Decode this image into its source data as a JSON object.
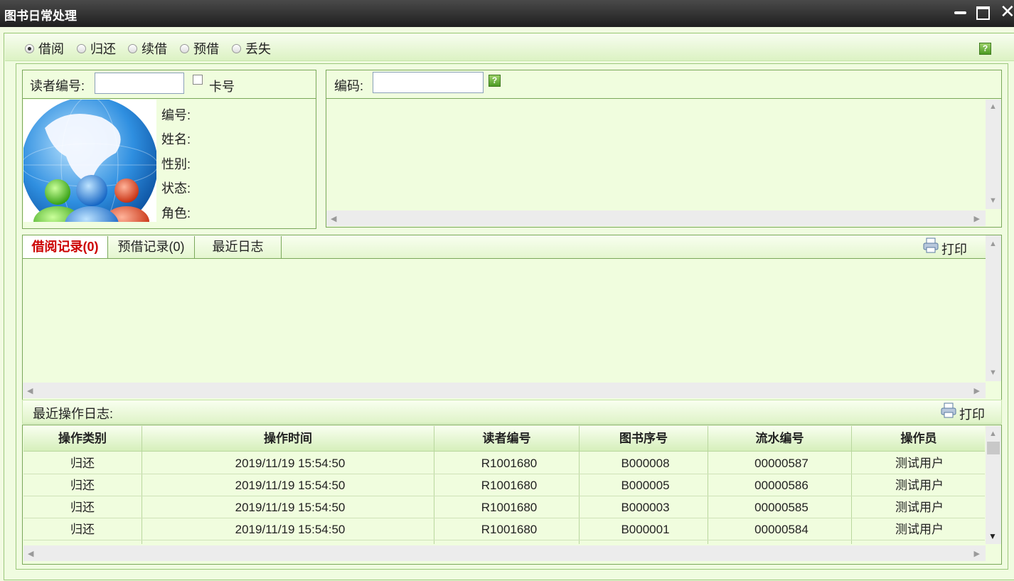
{
  "window": {
    "title": "图书日常处理"
  },
  "mode": {
    "options": [
      "借阅",
      "归还",
      "续借",
      "预借",
      "丢失"
    ],
    "selected": "借阅"
  },
  "reader": {
    "id_label": "读者编号:",
    "id_value": "",
    "card_checkbox_label": "卡号",
    "card_checked": false,
    "fields": [
      "编号:",
      "姓名:",
      "性别:",
      "状态:",
      "角色:"
    ]
  },
  "code": {
    "label": "编码:",
    "value": ""
  },
  "tabs": {
    "items": [
      "借阅记录(0)",
      "预借记录(0)",
      "最近日志"
    ],
    "active": "借阅记录(0)",
    "print_label": "打印"
  },
  "log": {
    "title": "最近操作日志:",
    "print_label": "打印",
    "columns": [
      "操作类别",
      "操作时间",
      "读者编号",
      "图书序号",
      "流水编号",
      "操作员"
    ],
    "rows": [
      [
        "归还",
        "2019/11/19 15:54:50",
        "R1001680",
        "B000008",
        "00000587",
        "测试用户"
      ],
      [
        "归还",
        "2019/11/19 15:54:50",
        "R1001680",
        "B000005",
        "00000586",
        "测试用户"
      ],
      [
        "归还",
        "2019/11/19 15:54:50",
        "R1001680",
        "B000003",
        "00000585",
        "测试用户"
      ],
      [
        "归还",
        "2019/11/19 15:54:50",
        "R1001680",
        "B000001",
        "00000584",
        "测试用户"
      ]
    ]
  },
  "colors": {
    "panel_bg": "#f0fdde",
    "border": "#7aa85a",
    "active_tab": "#cc0000",
    "titlebar": "#2b2b2b"
  }
}
